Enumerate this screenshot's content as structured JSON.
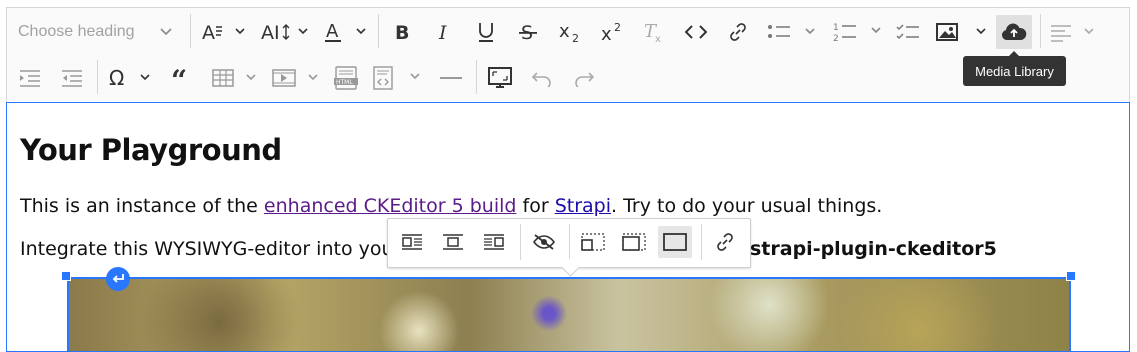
{
  "toolbar": {
    "heading_placeholder": "Choose heading",
    "tooltip": "Media Library"
  },
  "editor": {
    "heading": "Your Playground",
    "para1": {
      "before": "This is an instance of the ",
      "link1": "enhanced CKEditor 5 build",
      "mid": " for ",
      "link2": "Strapi",
      "after": ". Try to do your usual things."
    },
    "para2": {
      "before": "Integrate this WYSIWYG-editor into your S",
      "bold": "strapi-plugin-ckeditor5"
    }
  },
  "image_toolbar": {
    "icons": [
      "wrap-left-icon",
      "center-icon",
      "wrap-right-icon",
      "toggle-visibility-icon",
      "resize-small-icon",
      "resize-medium-icon",
      "resize-full-icon",
      "link-icon"
    ]
  },
  "colors": {
    "accent": "#2977ff",
    "tooltip_bg": "#333333",
    "toolbar_bg": "#fafafa"
  }
}
